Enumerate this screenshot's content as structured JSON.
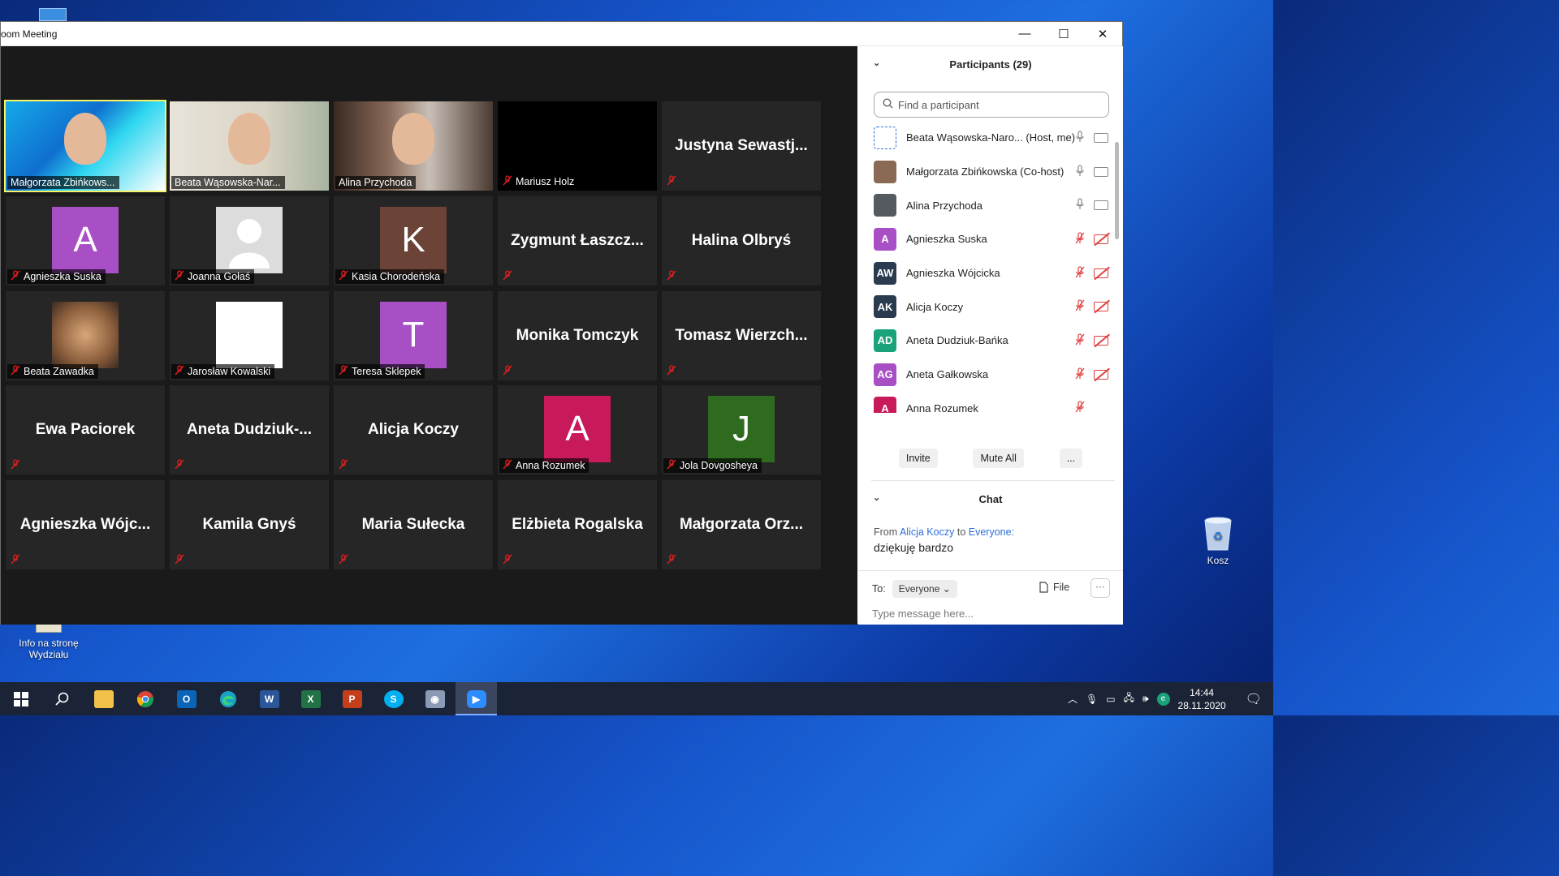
{
  "window": {
    "title": "oom Meeting",
    "minimize": "—",
    "maximize": "☐",
    "close": "✕"
  },
  "desktop": {
    "info_icon_label_1": "Info na stronę",
    "info_icon_label_2": "Wydziału",
    "recycle_label": "Kosz"
  },
  "tiles": [
    {
      "name": "Małgorzata Zbińkows...",
      "type": "photo",
      "muted": false
    },
    {
      "name": "Beata Wąsowska-Nar...",
      "type": "photo",
      "muted": false
    },
    {
      "name": "Alina Przychoda",
      "type": "photo",
      "muted": false
    },
    {
      "name": "Mariusz Holz",
      "type": "black",
      "muted": true
    },
    {
      "big": "Justyna  Sewastj...",
      "type": "text",
      "muted": true
    },
    {
      "name": "Agnieszka Suska",
      "type": "avatar",
      "letter": "A",
      "color": "#a94fc5",
      "muted": true
    },
    {
      "name": "Joanna Gołaś",
      "type": "silhouette",
      "muted": true
    },
    {
      "name": "Kasia Chorodeńska",
      "type": "avatar",
      "letter": "K",
      "color": "#6b4337",
      "muted": true
    },
    {
      "big": "Zygmunt  Łaszcz...",
      "type": "text",
      "muted": true
    },
    {
      "big": "Halina Olbryś",
      "type": "text",
      "muted": true
    },
    {
      "name": "Beata Zawadka",
      "type": "photo",
      "muted": true
    },
    {
      "name": "Jarosław Kowalski",
      "type": "photo",
      "muted": true
    },
    {
      "name": "Teresa Sklepek",
      "type": "avatar",
      "letter": "T",
      "color": "#a94fc5",
      "muted": true
    },
    {
      "big": "Monika Tomczyk",
      "type": "text",
      "muted": true
    },
    {
      "big": "Tomasz  Wierzch...",
      "type": "text",
      "muted": true
    },
    {
      "big": "Ewa Paciorek",
      "type": "text",
      "muted": true
    },
    {
      "big": "Aneta  Dudziuk-...",
      "type": "text",
      "muted": true
    },
    {
      "big": "Alicja Koczy",
      "type": "text",
      "muted": true
    },
    {
      "name": "Anna Rozumek",
      "type": "avatar",
      "letter": "A",
      "color": "#c81a5a",
      "muted": true
    },
    {
      "name": "Jola Dovgosheya",
      "type": "avatar",
      "letter": "J",
      "color": "#2f6b1f",
      "muted": true
    },
    {
      "big": "Agnieszka  Wójc...",
      "type": "text",
      "muted": true
    },
    {
      "big": "Kamila Gnyś",
      "type": "text",
      "muted": true
    },
    {
      "big": "Maria Sułecka",
      "type": "text",
      "muted": true
    },
    {
      "big": "Elżbieta Rogalska",
      "type": "text",
      "muted": true
    },
    {
      "big": "Małgorzata  Orz...",
      "type": "text",
      "muted": true
    }
  ],
  "participants": {
    "title": "Participants (29)",
    "search_placeholder": "Find a participant",
    "items": [
      {
        "name": "Beata Wąsowska-Naro... (Host, me)",
        "initials": "",
        "color": "#ffffff",
        "mic": "on",
        "cam": "on",
        "avatar_kind": "pattern"
      },
      {
        "name": "Małgorzata Zbińkowska (Co-host)",
        "initials": "",
        "color": "#8a6a55",
        "mic": "on",
        "cam": "on",
        "avatar_kind": "photo"
      },
      {
        "name": "Alina Przychoda",
        "initials": "",
        "color": "#555a60",
        "mic": "on",
        "cam": "on",
        "avatar_kind": "photo"
      },
      {
        "name": "Agnieszka Suska",
        "initials": "A",
        "color": "#a94fc5",
        "mic": "off",
        "cam": "off"
      },
      {
        "name": "Agnieszka Wójcicka",
        "initials": "AW",
        "color": "#2a3a4f",
        "mic": "off",
        "cam": "off"
      },
      {
        "name": "Alicja Koczy",
        "initials": "AK",
        "color": "#2a3a4f",
        "mic": "off",
        "cam": "off"
      },
      {
        "name": "Aneta Dudziuk-Bańka",
        "initials": "AD",
        "color": "#1aa37a",
        "mic": "off",
        "cam": "off"
      },
      {
        "name": "Aneta Gałkowska",
        "initials": "AG",
        "color": "#a94fc5",
        "mic": "off",
        "cam": "off"
      },
      {
        "name": "Anna Rozumek",
        "initials": "A",
        "color": "#c81a5a",
        "mic": "off",
        "cam": "none"
      }
    ],
    "invite_label": "Invite",
    "mute_all_label": "Mute All",
    "more_label": "..."
  },
  "chat": {
    "title": "Chat",
    "from_prefix": "From",
    "from_name": "Alicja Koczy",
    "to_word": "to",
    "to_target": "Everyone:",
    "message": "dziękuję bardzo",
    "to_label": "To:",
    "to_select": "Everyone",
    "file_label": "File",
    "more_label": "···",
    "input_placeholder": "Type message here..."
  },
  "taskbar": {
    "time": "14:44",
    "date": "28.11.2020"
  }
}
